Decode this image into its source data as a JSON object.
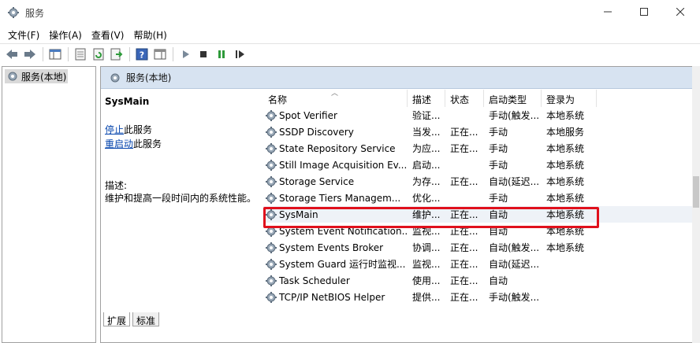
{
  "window": {
    "title": "服务"
  },
  "menu": [
    "文件(F)",
    "操作(A)",
    "查看(V)",
    "帮助(H)"
  ],
  "tree": {
    "item": "服务(本地)"
  },
  "pane": {
    "header": "服务(本地)",
    "selected_name": "SysMain",
    "action_stop_link": "停止",
    "action_stop_suffix": "此服务",
    "action_restart_link": "重启动",
    "action_restart_suffix": "此服务",
    "desc_label": "描述:",
    "desc_text": "维护和提高一段时间内的系统性能。"
  },
  "table": {
    "headers": [
      "名称",
      "描述",
      "状态",
      "启动类型",
      "登录为"
    ],
    "rows": [
      {
        "name": "Spot Verifier",
        "desc": "验证...",
        "status": "",
        "start": "手动(触发...",
        "logon": "本地系统"
      },
      {
        "name": "SSDP Discovery",
        "desc": "当发...",
        "status": "正在...",
        "start": "手动",
        "logon": "本地服务"
      },
      {
        "name": "State Repository Service",
        "desc": "为应...",
        "status": "正在...",
        "start": "手动",
        "logon": "本地系统"
      },
      {
        "name": "Still Image Acquisition Ev...",
        "desc": "启动...",
        "status": "",
        "start": "手动",
        "logon": "本地系统"
      },
      {
        "name": "Storage Service",
        "desc": "为存...",
        "status": "正在...",
        "start": "自动(延迟...",
        "logon": "本地系统"
      },
      {
        "name": "Storage Tiers Managem...",
        "desc": "优化...",
        "status": "",
        "start": "手动",
        "logon": "本地系统"
      },
      {
        "name": "SysMain",
        "desc": "维护...",
        "status": "正在...",
        "start": "自动",
        "logon": "本地系统"
      },
      {
        "name": "System Event Notification...",
        "desc": "监视...",
        "status": "正在...",
        "start": "自动",
        "logon": "本地系统"
      },
      {
        "name": "System Events Broker",
        "desc": "协调...",
        "status": "正在...",
        "start": "自动(触发...",
        "logon": "本地系统"
      },
      {
        "name": "System Guard 运行时监视...",
        "desc": "监视...",
        "status": "正在...",
        "start": "自动(延迟...",
        "logon": ""
      },
      {
        "name": "Task Scheduler",
        "desc": "使用...",
        "status": "正在...",
        "start": "自动",
        "logon": ""
      },
      {
        "name": "TCP/IP NetBIOS Helper",
        "desc": "提供...",
        "status": "正在...",
        "start": "手动(触发...",
        "logon": ""
      }
    ]
  },
  "tabs": [
    "扩展",
    "标准"
  ]
}
